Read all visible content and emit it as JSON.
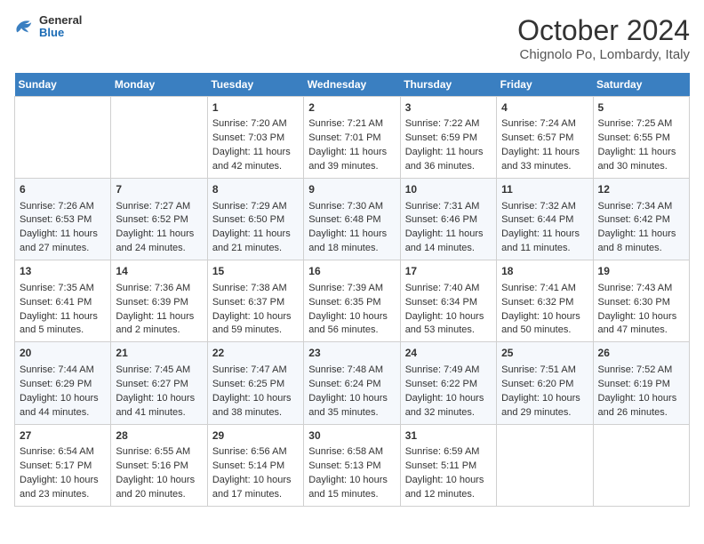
{
  "header": {
    "logo_general": "General",
    "logo_blue": "Blue",
    "month_title": "October 2024",
    "location": "Chignolo Po, Lombardy, Italy"
  },
  "days_of_week": [
    "Sunday",
    "Monday",
    "Tuesday",
    "Wednesday",
    "Thursday",
    "Friday",
    "Saturday"
  ],
  "weeks": [
    [
      {
        "day": "",
        "sunrise": "",
        "sunset": "",
        "daylight": ""
      },
      {
        "day": "",
        "sunrise": "",
        "sunset": "",
        "daylight": ""
      },
      {
        "day": "1",
        "sunrise": "Sunrise: 7:20 AM",
        "sunset": "Sunset: 7:03 PM",
        "daylight": "Daylight: 11 hours and 42 minutes."
      },
      {
        "day": "2",
        "sunrise": "Sunrise: 7:21 AM",
        "sunset": "Sunset: 7:01 PM",
        "daylight": "Daylight: 11 hours and 39 minutes."
      },
      {
        "day": "3",
        "sunrise": "Sunrise: 7:22 AM",
        "sunset": "Sunset: 6:59 PM",
        "daylight": "Daylight: 11 hours and 36 minutes."
      },
      {
        "day": "4",
        "sunrise": "Sunrise: 7:24 AM",
        "sunset": "Sunset: 6:57 PM",
        "daylight": "Daylight: 11 hours and 33 minutes."
      },
      {
        "day": "5",
        "sunrise": "Sunrise: 7:25 AM",
        "sunset": "Sunset: 6:55 PM",
        "daylight": "Daylight: 11 hours and 30 minutes."
      }
    ],
    [
      {
        "day": "6",
        "sunrise": "Sunrise: 7:26 AM",
        "sunset": "Sunset: 6:53 PM",
        "daylight": "Daylight: 11 hours and 27 minutes."
      },
      {
        "day": "7",
        "sunrise": "Sunrise: 7:27 AM",
        "sunset": "Sunset: 6:52 PM",
        "daylight": "Daylight: 11 hours and 24 minutes."
      },
      {
        "day": "8",
        "sunrise": "Sunrise: 7:29 AM",
        "sunset": "Sunset: 6:50 PM",
        "daylight": "Daylight: 11 hours and 21 minutes."
      },
      {
        "day": "9",
        "sunrise": "Sunrise: 7:30 AM",
        "sunset": "Sunset: 6:48 PM",
        "daylight": "Daylight: 11 hours and 18 minutes."
      },
      {
        "day": "10",
        "sunrise": "Sunrise: 7:31 AM",
        "sunset": "Sunset: 6:46 PM",
        "daylight": "Daylight: 11 hours and 14 minutes."
      },
      {
        "day": "11",
        "sunrise": "Sunrise: 7:32 AM",
        "sunset": "Sunset: 6:44 PM",
        "daylight": "Daylight: 11 hours and 11 minutes."
      },
      {
        "day": "12",
        "sunrise": "Sunrise: 7:34 AM",
        "sunset": "Sunset: 6:42 PM",
        "daylight": "Daylight: 11 hours and 8 minutes."
      }
    ],
    [
      {
        "day": "13",
        "sunrise": "Sunrise: 7:35 AM",
        "sunset": "Sunset: 6:41 PM",
        "daylight": "Daylight: 11 hours and 5 minutes."
      },
      {
        "day": "14",
        "sunrise": "Sunrise: 7:36 AM",
        "sunset": "Sunset: 6:39 PM",
        "daylight": "Daylight: 11 hours and 2 minutes."
      },
      {
        "day": "15",
        "sunrise": "Sunrise: 7:38 AM",
        "sunset": "Sunset: 6:37 PM",
        "daylight": "Daylight: 10 hours and 59 minutes."
      },
      {
        "day": "16",
        "sunrise": "Sunrise: 7:39 AM",
        "sunset": "Sunset: 6:35 PM",
        "daylight": "Daylight: 10 hours and 56 minutes."
      },
      {
        "day": "17",
        "sunrise": "Sunrise: 7:40 AM",
        "sunset": "Sunset: 6:34 PM",
        "daylight": "Daylight: 10 hours and 53 minutes."
      },
      {
        "day": "18",
        "sunrise": "Sunrise: 7:41 AM",
        "sunset": "Sunset: 6:32 PM",
        "daylight": "Daylight: 10 hours and 50 minutes."
      },
      {
        "day": "19",
        "sunrise": "Sunrise: 7:43 AM",
        "sunset": "Sunset: 6:30 PM",
        "daylight": "Daylight: 10 hours and 47 minutes."
      }
    ],
    [
      {
        "day": "20",
        "sunrise": "Sunrise: 7:44 AM",
        "sunset": "Sunset: 6:29 PM",
        "daylight": "Daylight: 10 hours and 44 minutes."
      },
      {
        "day": "21",
        "sunrise": "Sunrise: 7:45 AM",
        "sunset": "Sunset: 6:27 PM",
        "daylight": "Daylight: 10 hours and 41 minutes."
      },
      {
        "day": "22",
        "sunrise": "Sunrise: 7:47 AM",
        "sunset": "Sunset: 6:25 PM",
        "daylight": "Daylight: 10 hours and 38 minutes."
      },
      {
        "day": "23",
        "sunrise": "Sunrise: 7:48 AM",
        "sunset": "Sunset: 6:24 PM",
        "daylight": "Daylight: 10 hours and 35 minutes."
      },
      {
        "day": "24",
        "sunrise": "Sunrise: 7:49 AM",
        "sunset": "Sunset: 6:22 PM",
        "daylight": "Daylight: 10 hours and 32 minutes."
      },
      {
        "day": "25",
        "sunrise": "Sunrise: 7:51 AM",
        "sunset": "Sunset: 6:20 PM",
        "daylight": "Daylight: 10 hours and 29 minutes."
      },
      {
        "day": "26",
        "sunrise": "Sunrise: 7:52 AM",
        "sunset": "Sunset: 6:19 PM",
        "daylight": "Daylight: 10 hours and 26 minutes."
      }
    ],
    [
      {
        "day": "27",
        "sunrise": "Sunrise: 6:54 AM",
        "sunset": "Sunset: 5:17 PM",
        "daylight": "Daylight: 10 hours and 23 minutes."
      },
      {
        "day": "28",
        "sunrise": "Sunrise: 6:55 AM",
        "sunset": "Sunset: 5:16 PM",
        "daylight": "Daylight: 10 hours and 20 minutes."
      },
      {
        "day": "29",
        "sunrise": "Sunrise: 6:56 AM",
        "sunset": "Sunset: 5:14 PM",
        "daylight": "Daylight: 10 hours and 17 minutes."
      },
      {
        "day": "30",
        "sunrise": "Sunrise: 6:58 AM",
        "sunset": "Sunset: 5:13 PM",
        "daylight": "Daylight: 10 hours and 15 minutes."
      },
      {
        "day": "31",
        "sunrise": "Sunrise: 6:59 AM",
        "sunset": "Sunset: 5:11 PM",
        "daylight": "Daylight: 10 hours and 12 minutes."
      },
      {
        "day": "",
        "sunrise": "",
        "sunset": "",
        "daylight": ""
      },
      {
        "day": "",
        "sunrise": "",
        "sunset": "",
        "daylight": ""
      }
    ]
  ]
}
